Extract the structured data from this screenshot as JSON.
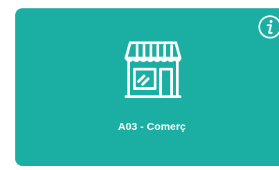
{
  "card": {
    "label": "A03 - Comerç",
    "icon": "shop-storefront-icon",
    "background_color": "#1baea3",
    "text_color": "#ffffff"
  },
  "info_button": {
    "icon": "info-icon"
  }
}
